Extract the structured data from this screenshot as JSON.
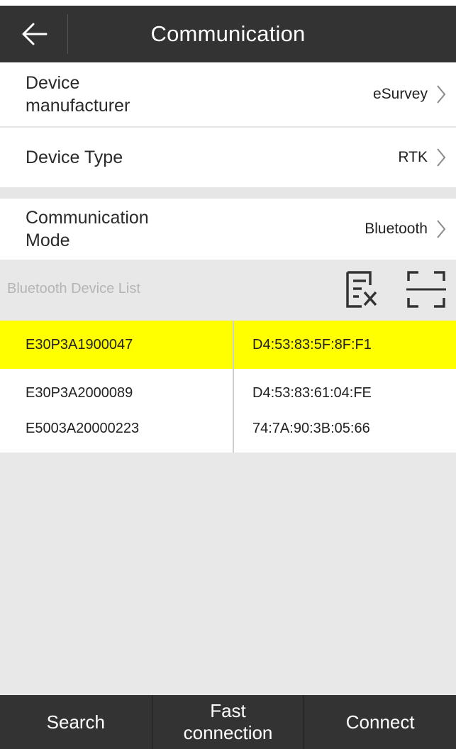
{
  "header": {
    "title": "Communication",
    "back_icon": "arrow-left-icon"
  },
  "settings": {
    "manufacturer": {
      "label_line1": "Device",
      "label_line2": "manufacturer",
      "value": "eSurvey"
    },
    "device_type": {
      "label": "Device Type",
      "value": "RTK"
    },
    "mode": {
      "label_line1": "Communication",
      "label_line2": "Mode",
      "value": "Bluetooth"
    }
  },
  "device_list": {
    "title": "Bluetooth Device List",
    "icons": [
      "clear-list-icon",
      "scan-frame-icon"
    ],
    "highlight_color": "#ffff00",
    "devices": [
      {
        "name": "E30P3A1900047",
        "mac": "D4:53:83:5F:8F:F1",
        "selected": true
      },
      {
        "name": "E30P3A2000089",
        "mac": "D4:53:83:61:04:FE",
        "selected": false
      },
      {
        "name": "E5003A20000223",
        "mac": "74:7A:90:3B:05:66",
        "selected": false
      }
    ]
  },
  "bottom_bar": {
    "search": "Search",
    "fast_connection_line1": "Fast",
    "fast_connection_line2": "connection",
    "connect": "Connect"
  }
}
